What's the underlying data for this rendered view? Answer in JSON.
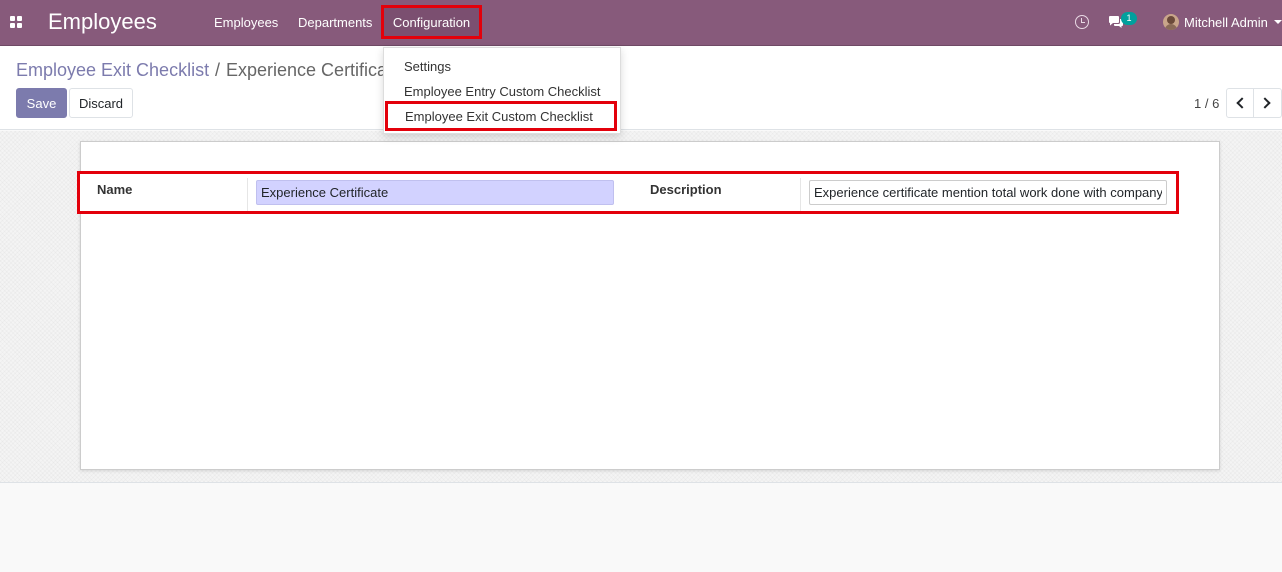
{
  "navbar": {
    "brand": "Employees",
    "menu": {
      "employees": "Employees",
      "departments": "Departments",
      "configuration": "Configuration"
    },
    "chat_badge": "1",
    "user_name": "Mitchell Admin",
    "icons": [
      "apps-grid-icon",
      "clock-icon",
      "chat-icon",
      "avatar"
    ]
  },
  "dropdown": {
    "settings": "Settings",
    "entry_checklist": "Employee Entry Custom Checklist",
    "exit_checklist": "Employee Exit Custom Checklist"
  },
  "breadcrumb": {
    "parent": "Employee Exit Checklist",
    "separator": "/",
    "current": "Experience Certificate"
  },
  "buttons": {
    "save": "Save",
    "discard": "Discard"
  },
  "pager": {
    "value": "1 / 6"
  },
  "form": {
    "name_label": "Name",
    "name_value": "Experience Certificate",
    "description_label": "Description",
    "description_value": "Experience certificate mention total work done with company"
  },
  "colors": {
    "navbar": "#875a7b",
    "primary": "#7c7bad",
    "highlight": "#e3000b",
    "name_input_bg": "#d2d2ff"
  }
}
